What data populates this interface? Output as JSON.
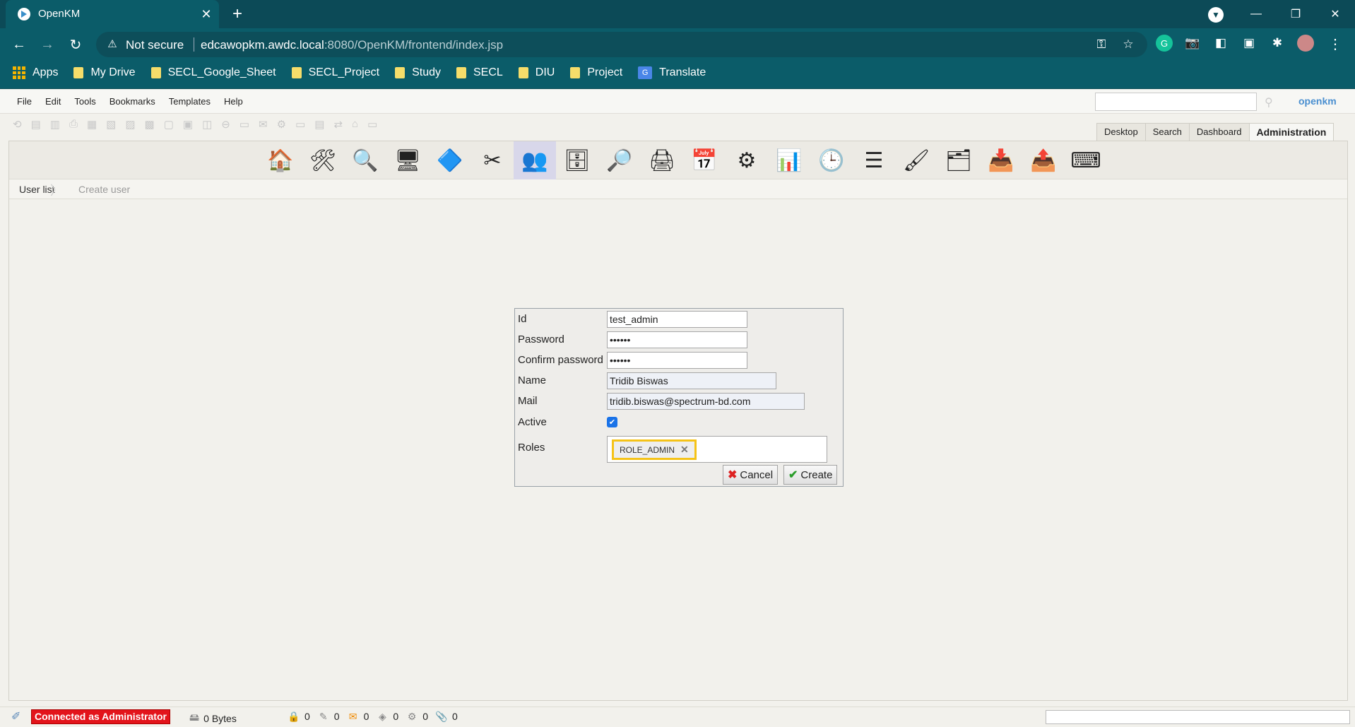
{
  "browser": {
    "tab_title": "OpenKM",
    "security_label": "Not secure",
    "url_host": "edcawopkm.awdc.local",
    "url_path": ":8080/OpenKM/frontend/index.jsp"
  },
  "bookmarks": [
    "Apps",
    "My Drive",
    "SECL_Google_Sheet",
    "SECL_Project",
    "Study",
    "SECL",
    "DIU",
    "Project",
    "Translate"
  ],
  "menu": [
    "File",
    "Edit",
    "Tools",
    "Bookmarks",
    "Templates",
    "Help"
  ],
  "logo": "openkm",
  "views": [
    "Desktop",
    "Search",
    "Dashboard",
    "Administration"
  ],
  "admin_icons": [
    {
      "name": "home-icon",
      "glyph": "🏠"
    },
    {
      "name": "tools-icon",
      "glyph": "🛠"
    },
    {
      "name": "search-doc-icon",
      "glyph": "🔍"
    },
    {
      "name": "monitor-icon",
      "glyph": "🖥"
    },
    {
      "name": "diamond-icon",
      "glyph": "🔷"
    },
    {
      "name": "scissors-icon",
      "glyph": "✂"
    },
    {
      "name": "users-icon",
      "glyph": "👥",
      "selected": true
    },
    {
      "name": "database-icon",
      "glyph": "🗄"
    },
    {
      "name": "magnifier-icon",
      "glyph": "🔎"
    },
    {
      "name": "printer-icon",
      "glyph": "🖨"
    },
    {
      "name": "calendar-icon",
      "glyph": "📅"
    },
    {
      "name": "gear-icon",
      "glyph": "⚙"
    },
    {
      "name": "report-icon",
      "glyph": "📊"
    },
    {
      "name": "clock-icon",
      "glyph": "🕒"
    },
    {
      "name": "list-icon",
      "glyph": "☰"
    },
    {
      "name": "brush-icon",
      "glyph": "🖌"
    },
    {
      "name": "folders-icon",
      "glyph": "🗂"
    },
    {
      "name": "import-icon",
      "glyph": "📥"
    },
    {
      "name": "export-icon",
      "glyph": "📤"
    },
    {
      "name": "terminal-icon",
      "glyph": "⌨"
    }
  ],
  "breadcrumb": {
    "first": "User list",
    "second": "Create user"
  },
  "form": {
    "id_label": "Id",
    "id_value": "test_admin",
    "password_label": "Password",
    "password_value": "••••••",
    "confirm_label": "Confirm password",
    "confirm_value": "••••••",
    "name_label": "Name",
    "name_value": "Tridib Biswas",
    "mail_label": "Mail",
    "mail_value": "tridib.biswas@spectrum-bd.com",
    "active_label": "Active",
    "active_checked": true,
    "roles_label": "Roles",
    "role_chip": "ROLE_ADMIN",
    "cancel_label": "Cancel",
    "create_label": "Create"
  },
  "status": {
    "connected": "Connected as Administrator",
    "bytes": "0 Bytes",
    "counters": [
      "0",
      "0",
      "0",
      "0",
      "0",
      "0"
    ]
  },
  "colors": {
    "accent": "#0b5c69",
    "highlight": "#f5c318",
    "alert": "#e3141b"
  }
}
